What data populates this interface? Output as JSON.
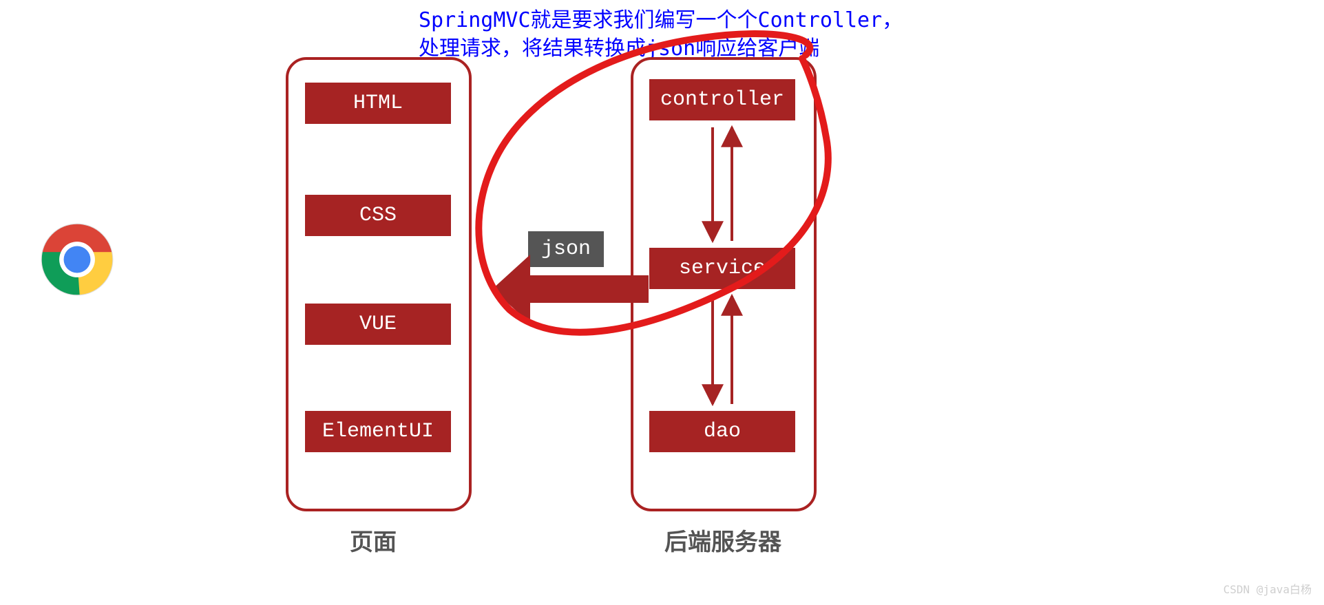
{
  "annotation": {
    "line1": "SpringMVC就是要求我们编写一个个Controller，",
    "line2": "处理请求，将结果转换成json响应给客户端"
  },
  "frontend": {
    "caption": "页面",
    "items": [
      "HTML",
      "CSS",
      "VUE",
      "ElementUI"
    ]
  },
  "backend": {
    "caption": "后端服务器",
    "layers": [
      "controller",
      "service",
      "dao"
    ]
  },
  "json_label": "json",
  "watermark": "CSDN @java白杨",
  "icons": {
    "chrome": "chrome-browser-icon"
  },
  "colors": {
    "box_bg": "#a62323",
    "panel_border": "#a22",
    "annotation_text": "#0000ff",
    "json_bg": "#555555",
    "caption_text": "#545454",
    "highlight_stroke": "#e31b1b"
  }
}
